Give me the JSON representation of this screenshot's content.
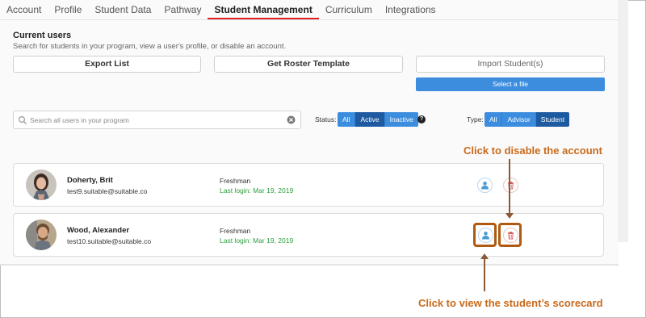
{
  "tabs": [
    {
      "label": "Account"
    },
    {
      "label": "Profile"
    },
    {
      "label": "Student Data"
    },
    {
      "label": "Pathway"
    },
    {
      "label": "Student Management"
    },
    {
      "label": "Curriculum"
    },
    {
      "label": "Integrations"
    }
  ],
  "active_tab": "Student Management",
  "section": {
    "title": "Current users",
    "description": "Search for students in your program, view a user's profile, or disable an account."
  },
  "actions": {
    "export_label": "Export List",
    "roster_label": "Get Roster Template",
    "import_label": "Import Student(s)",
    "select_file_label": "Select a file"
  },
  "search": {
    "placeholder": "Search all users in your program",
    "value": ""
  },
  "status_filter": {
    "label": "Status:",
    "options": [
      "All",
      "Active",
      "Inactive"
    ],
    "selected": "Active"
  },
  "type_filter": {
    "label": "Type:",
    "options": [
      "All",
      "Advisor",
      "Student"
    ],
    "selected": "Student"
  },
  "users": [
    {
      "name": "Doherty, Brit",
      "email": "test9.suitable@suitable.co",
      "level": "Freshman",
      "last_login": "Last login: Mar 19, 2019"
    },
    {
      "name": "Wood, Alexander",
      "email": "test10.suitable@suitable.co",
      "level": "Freshman",
      "last_login": "Last login: Mar 19, 2019"
    }
  ],
  "callouts": {
    "disable": "Click to disable the account",
    "scorecard": "Click to view the student’s scorecard"
  },
  "colors": {
    "accent_blue": "#3c8dde",
    "selected_blue": "#1d5aa0",
    "tab_underline": "#e02020",
    "login_green": "#2e9e3e",
    "callout_orange": "#c96a1a"
  },
  "icons": {
    "view": "user-icon",
    "disable": "trash-icon",
    "search": "search-icon",
    "clear": "clear-icon",
    "help": "help-icon"
  }
}
